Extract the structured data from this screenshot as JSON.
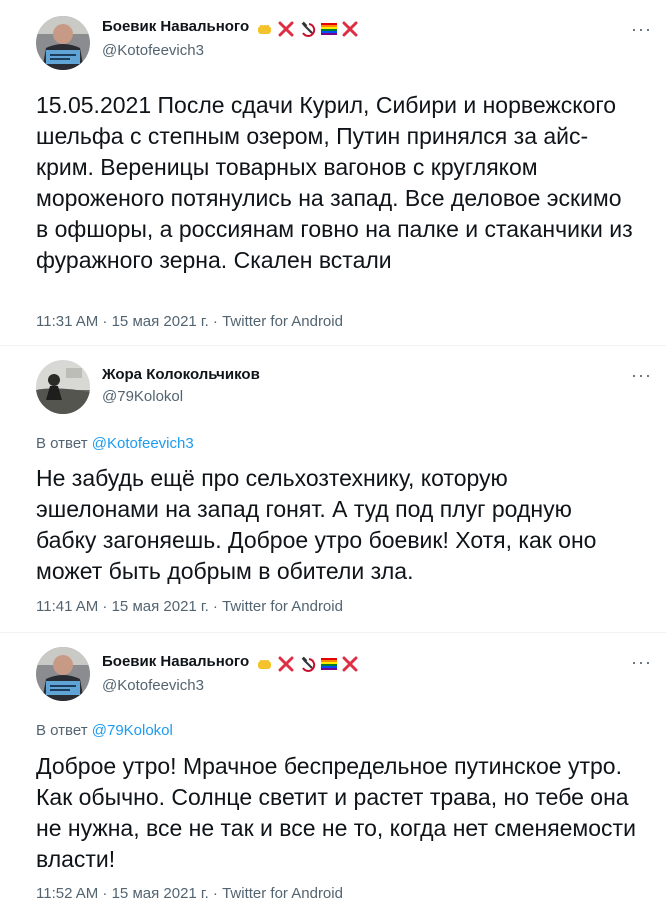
{
  "tweets": [
    {
      "author_name": "Боевик Навального",
      "author_handle": "@Kotofeevich3",
      "text": "15.05.2021 После сдачи Курил, Сибири и норвежского шельфа с степным озером, Путин принялся за айс-крим. Вереницы товарных вагонов с кругляком мороженого потянулись на запад. Все деловое эскимо в офшоры, а россиянам говно на палке и стаканчики из фуражного зерна. Скален встали",
      "meta": "11:31 AM · 15 мая 2021 г. · Twitter for Android",
      "more": "···",
      "emojis": [
        "fist-emoji",
        "cross-mark-emoji",
        "hammer-sickle-emoji",
        "rainbow-flag-emoji",
        "cross-mark-emoji"
      ]
    },
    {
      "author_name": "Жора Колокольчиков",
      "author_handle": "@79Kolokol",
      "reply_prefix": "В ответ",
      "reply_handle": "@Kotofeevich3",
      "text": "Не забудь ещё про сельхозтехнику, которую эшелонами на запад гонят. А туд под плуг родную бабку загоняешь. Доброе утро боевик! Хотя, как оно может быть добрым в обители зла.",
      "meta": "11:41 AM · 15 мая 2021 г. · Twitter for Android",
      "more": "···"
    },
    {
      "author_name": "Боевик Навального",
      "author_handle": "@Kotofeevich3",
      "reply_prefix": "В ответ",
      "reply_handle": "@79Kolokol",
      "text": "Доброе утро! Мрачное беспредельное путинское утро. Как обычно. Солнце светит и растет трава, но тебе она не нужна, все не так и все не то, когда нет сменяемости власти!",
      "meta": "11:52 AM · 15 мая 2021 г. · Twitter for Android",
      "more": "···",
      "emojis": [
        "fist-emoji",
        "cross-mark-emoji",
        "hammer-sickle-emoji",
        "rainbow-flag-emoji",
        "cross-mark-emoji"
      ]
    }
  ],
  "colors": {
    "text": "#0f1419",
    "secondary": "#536471",
    "link": "#1d9bf0",
    "divider": "#eff3f4"
  }
}
